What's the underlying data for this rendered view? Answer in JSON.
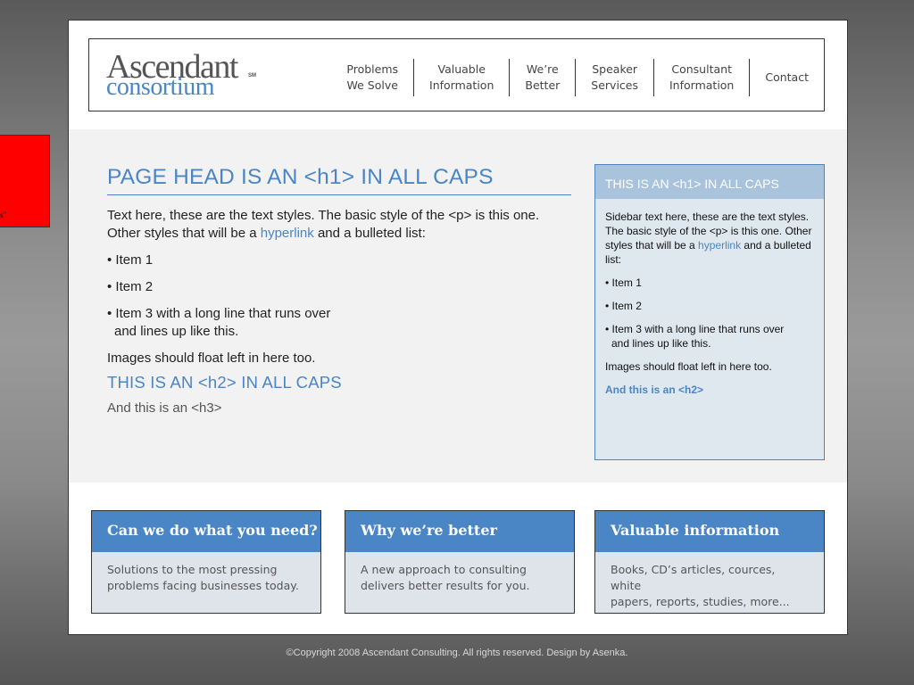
{
  "logo": {
    "line1": "Ascendant",
    "line2": "consortium",
    "mark": "SM"
  },
  "nav": [
    {
      "line1": "Problems",
      "line2": "We Solve"
    },
    {
      "line1": "Valuable",
      "line2": "Information"
    },
    {
      "line1": "We’re",
      "line2": "Better"
    },
    {
      "line1": "Speaker",
      "line2": "Services"
    },
    {
      "line1": "Consultant",
      "line2": "Information"
    },
    {
      "line1": "Contact",
      "line2": ""
    }
  ],
  "red_box": {
    "text": "s\""
  },
  "main": {
    "h1": "PAGE HEAD IS AN <h1> IN ALL CAPS",
    "para_before": "Text here, these are the text styles. The basic style of the <p> is this one. Other styles that will be a ",
    "link": "hyperlink",
    "para_after": " and a bulleted list:",
    "items": [
      "• Item 1",
      "• Item 2",
      "• Item 3 with a long line that runs over"
    ],
    "item3_cont": "and lines up like this.",
    "images_note": "Images should float left in here too.",
    "h2": "THIS IS AN <h2> IN ALL CAPS",
    "h3": "And this is an <h3>"
  },
  "sidebar": {
    "head": "THIS IS AN <h1> IN ALL CAPS",
    "para_before": "Sidebar text here, these are the text styles. The basic style of the <p> is this one. Other styles that will be a ",
    "link": "hyperlink",
    "para_after": " and a bulleted list:",
    "items": [
      "• Item 1",
      "• Item 2",
      "• Item 3 with a long line that runs over"
    ],
    "item3_cont": "and lines up like this.",
    "images_note": "Images should float left in here too.",
    "h2": "And this is an <h2>"
  },
  "boxes": [
    {
      "title": "Can we do what you need?",
      "line1": "Solutions to the most pressing",
      "line2": "problems facing businesses today."
    },
    {
      "title": "Why we’re better",
      "line1": "A new approach to consulting",
      "line2": "delivers better results for you."
    },
    {
      "title": "Valuable information",
      "line1": "Books, CD’s articles, cources, white",
      "line2": "papers, reports, studies, more..."
    }
  ],
  "footer": "©Copyright 2008 Ascendant Consulting. All rights reserved. Design by Asenka.",
  "colors": {
    "accent": "#4a86c5",
    "sidebar_bg": "#dfe7ef",
    "sidebar_head": "#a9c3dd",
    "content_bg": "#f2f2f2"
  }
}
